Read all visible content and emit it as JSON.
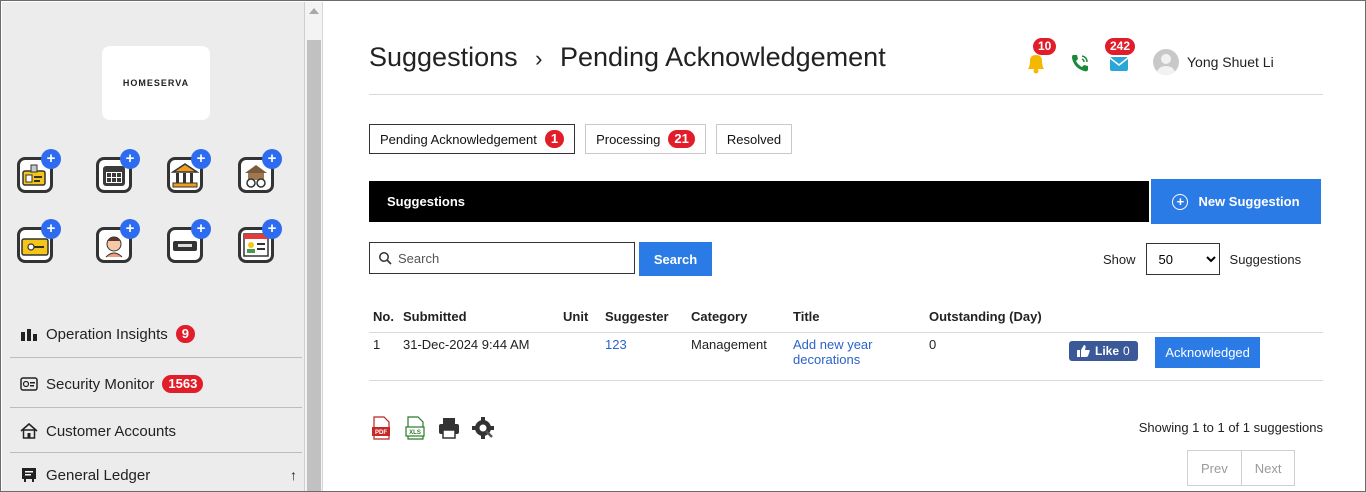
{
  "sidebar": {
    "logo_text": "HOMESERVA",
    "quick_icons": [
      {
        "name": "id-card-icon",
        "color": "#f5c518"
      },
      {
        "name": "calendar-icon",
        "color": "#3b3b3b"
      },
      {
        "name": "bank-icon",
        "color": "#f29c1f"
      },
      {
        "name": "facilities-icon",
        "color": "#7a5a3a"
      },
      {
        "name": "keycard-icon",
        "color": "#f5c518"
      },
      {
        "name": "visitor-icon",
        "color": "#f39c7a"
      },
      {
        "name": "license-plate-icon",
        "color": "#333333"
      },
      {
        "name": "login-icon",
        "color": "#f5c518"
      }
    ],
    "items": [
      {
        "label": "Operation Insights",
        "icon": "bar-chart-icon",
        "badge": "9"
      },
      {
        "label": "Security Monitor",
        "icon": "cctv-icon",
        "badge": "1563"
      },
      {
        "label": "Customer Accounts",
        "icon": "home-icon",
        "badge": ""
      },
      {
        "label": "General Ledger",
        "icon": "ledger-icon",
        "badge": ""
      }
    ],
    "collapse_arrow": "↑"
  },
  "header": {
    "breadcrumb_root": "Suggestions",
    "breadcrumb_sep": "›",
    "breadcrumb_current": "Pending Acknowledgement",
    "notifications_count": "10",
    "messages_count": "242",
    "user_name": "Yong Shuet Li"
  },
  "tabs": [
    {
      "label": "Pending Acknowledgement",
      "badge": "1"
    },
    {
      "label": "Processing",
      "badge": "21"
    },
    {
      "label": "Resolved",
      "badge": ""
    }
  ],
  "panel": {
    "title": "Suggestions",
    "new_button": "New Suggestion"
  },
  "search": {
    "placeholder": "Search",
    "button": "Search"
  },
  "show": {
    "label": "Show",
    "value": "50",
    "suffix": "Suggestions"
  },
  "table": {
    "headers": [
      "No.",
      "Submitted",
      "Unit",
      "Suggester",
      "Category",
      "Title",
      "Outstanding (Day)"
    ],
    "rows": [
      {
        "no": "1",
        "submitted": "31-Dec-2024 9:44 AM",
        "unit": "",
        "suggester": "123",
        "category": "Management",
        "title_line1": "Add new year",
        "title_line2": "decorations",
        "outstanding": "0",
        "like_label": "Like",
        "like_count": "0",
        "action": "Acknowledged"
      }
    ]
  },
  "footer": {
    "exports": [
      "pdf-icon",
      "xls-icon",
      "print-icon",
      "settings-icon"
    ],
    "pdf_label": "PDF",
    "xls_label": "XLS",
    "showing": "Showing 1 to 1 of 1 suggestions",
    "prev": "Prev",
    "next": "Next"
  },
  "colors": {
    "accent": "#2b7be6",
    "badge": "#e11d2a",
    "bar": "#000000",
    "link": "#2b63c9",
    "like": "#3b5998"
  }
}
